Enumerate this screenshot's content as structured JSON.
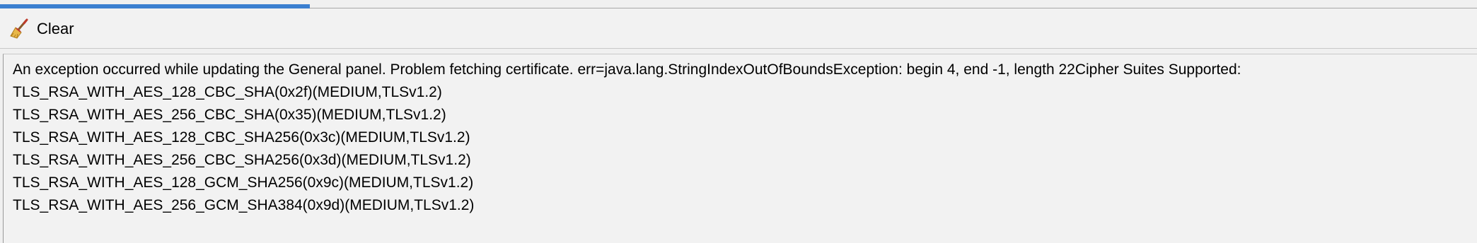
{
  "toolbar": {
    "clear_label": "Clear",
    "clear_icon": "broom-icon"
  },
  "progress": {
    "fraction": 0.21,
    "color": "#3b7fd0"
  },
  "output": {
    "lines": [
      "An exception occurred while updating the General panel. Problem fetching certificate. err=java.lang.StringIndexOutOfBoundsException: begin 4, end -1, length 22Cipher Suites Supported:",
      "TLS_RSA_WITH_AES_128_CBC_SHA(0x2f)(MEDIUM,TLSv1.2)",
      "TLS_RSA_WITH_AES_256_CBC_SHA(0x35)(MEDIUM,TLSv1.2)",
      "TLS_RSA_WITH_AES_128_CBC_SHA256(0x3c)(MEDIUM,TLSv1.2)",
      "TLS_RSA_WITH_AES_256_CBC_SHA256(0x3d)(MEDIUM,TLSv1.2)",
      "TLS_RSA_WITH_AES_128_GCM_SHA256(0x9c)(MEDIUM,TLSv1.2)",
      "TLS_RSA_WITH_AES_256_GCM_SHA384(0x9d)(MEDIUM,TLSv1.2)"
    ]
  }
}
